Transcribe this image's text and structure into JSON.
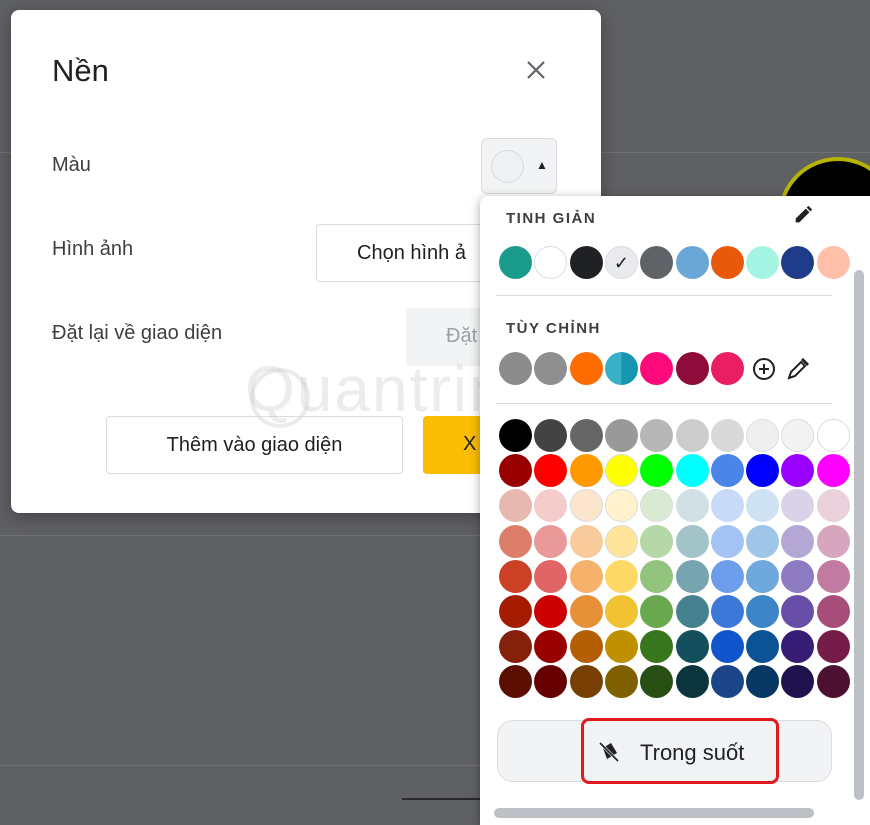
{
  "dialog": {
    "title": "Nền",
    "close_icon": "close-icon",
    "rows": {
      "color_label": "Màu",
      "image_label": "Hình ảnh",
      "reset_label": "Đặt lại về giao diện"
    },
    "buttons": {
      "choose_image": "Chọn hình ả",
      "reset": "Đặt",
      "add_to_theme": "Thêm vào giao diện",
      "done": "X"
    },
    "selected_color": "#eef0f1"
  },
  "watermark": "Quantrimang",
  "palette": {
    "simple_title": "TINH GIẢN",
    "custom_title": "TÙY CHỈNH",
    "simple_colors": [
      "#1a9a8a",
      "#ffffff",
      "#202124",
      "#e8eaed",
      "#5f6368",
      "#6aa7d6",
      "#e8590c",
      "#a4f4e4",
      "#1f3c88",
      "#ffbfa8"
    ],
    "simple_selected_index": 3,
    "custom_colors": [
      "#8c8c8c",
      "#8f8f8f",
      "#ff6d00",
      "split",
      "#ff0a7a",
      "#8e0c3a",
      "#e91e63"
    ],
    "grid": [
      [
        "#000000",
        "#434343",
        "#666666",
        "#999999",
        "#b7b7b7",
        "#cccccc",
        "#d9d9d9",
        "#efefef",
        "#f3f3f3",
        "#ffffff"
      ],
      [
        "#980000",
        "#ff0000",
        "#ff9900",
        "#ffff00",
        "#00ff00",
        "#00ffff",
        "#4a86e8",
        "#0000ff",
        "#9900ff",
        "#ff00ff"
      ],
      [
        "#e6b8af",
        "#f4cccc",
        "#fce5cd",
        "#fff2cc",
        "#d9ead3",
        "#d0e0e3",
        "#c9daf8",
        "#cfe2f3",
        "#d9d2e9",
        "#ead1dc"
      ],
      [
        "#dd7e6b",
        "#ea9999",
        "#f9cb9c",
        "#ffe599",
        "#b6d7a8",
        "#a2c4c9",
        "#a4c2f4",
        "#9fc5e8",
        "#b4a7d6",
        "#d5a6bd"
      ],
      [
        "#cc4125",
        "#e06666",
        "#f6b26b",
        "#ffd966",
        "#93c47d",
        "#76a5af",
        "#6d9eeb",
        "#6fa8dc",
        "#8e7cc3",
        "#c27ba0"
      ],
      [
        "#a61c00",
        "#cc0000",
        "#e69138",
        "#f1c232",
        "#6aa84f",
        "#45818e",
        "#3c78d8",
        "#3d85c6",
        "#674ea7",
        "#a64d79"
      ],
      [
        "#85200c",
        "#990000",
        "#b45f06",
        "#bf9000",
        "#38761d",
        "#134f5c",
        "#1155cc",
        "#0b5394",
        "#351c75",
        "#741b47"
      ],
      [
        "#5b0f00",
        "#660000",
        "#783f04",
        "#7f6000",
        "#274e13",
        "#0c343d",
        "#1c4587",
        "#073763",
        "#20124d",
        "#4c1130"
      ]
    ],
    "transparent_label": "Trong suốt"
  }
}
